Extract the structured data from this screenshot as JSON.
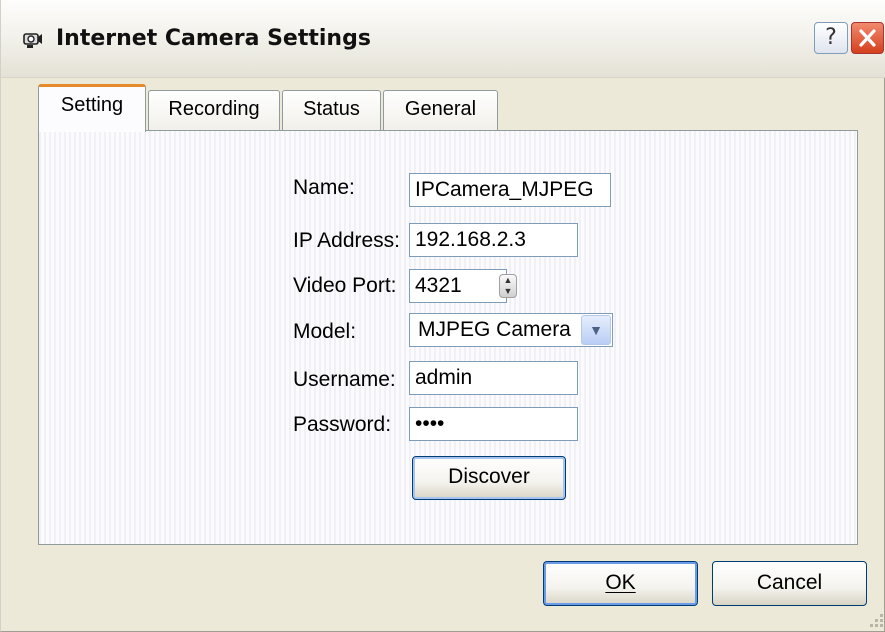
{
  "window": {
    "title": "Internet Camera Settings",
    "help_label": "?",
    "icon": "camera-icon"
  },
  "tabs": [
    {
      "label": "Setting",
      "active": true
    },
    {
      "label": "Recording",
      "active": false
    },
    {
      "label": "Status",
      "active": false
    },
    {
      "label": "General",
      "active": false
    }
  ],
  "form": {
    "name_label": "Name:",
    "name_value": "IPCamera_MJPEG",
    "ip_label": "IP Address:",
    "ip_value": "192.168.2.3",
    "port_label": "Video Port:",
    "port_value": "4321",
    "model_label": "Model:",
    "model_value": "MJPEG Camera",
    "username_label": "Username:",
    "username_value": "admin",
    "password_label": "Password:",
    "password_value": "••••",
    "discover_label": "Discover"
  },
  "footer": {
    "ok_label": "OK",
    "cancel_label": "Cancel"
  },
  "colors": {
    "accent_tab": "#e68b2c",
    "close_button": "#d4401c",
    "dialog_bg": "#ece9d8"
  }
}
